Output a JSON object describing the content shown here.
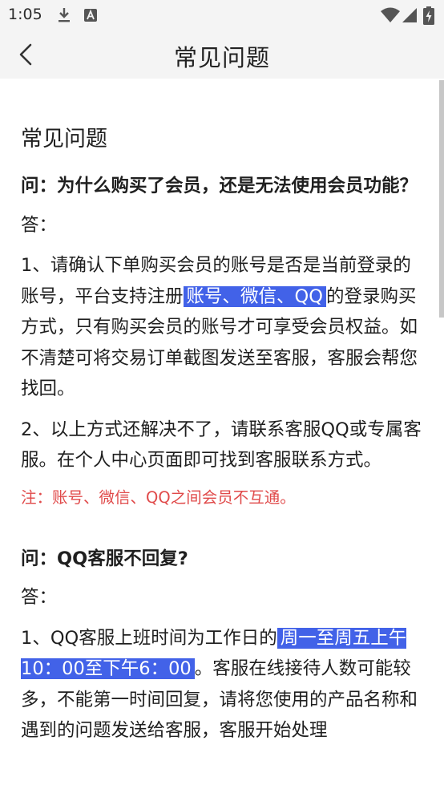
{
  "status_bar": {
    "time": "1:05",
    "icons": [
      "download-icon",
      "font-a-icon",
      "wifi-icon",
      "signal-icon",
      "battery-charging-icon"
    ]
  },
  "app_bar": {
    "title": "常见问题"
  },
  "content": {
    "section_title": "常见问题",
    "faq": [
      {
        "question": "问：为什么购买了会员，还是无法使用会员功能？",
        "answer_label": "答：",
        "para1": {
          "before": "1、请确认下单购买会员的账号是否是当前登录的账号，平台支持注册",
          "highlight": "账号、微信、QQ",
          "after": "的登录购买方式，只有购买会员的账号才可享受会员权益。如不清楚可将交易订单截图发送至客服，客服会帮您找回。"
        },
        "para2": "2、以上方式还解决不了，请联系客服QQ或专属客服。在个人中心页面即可找到客服联系方式。",
        "note": "注：账号、微信、QQ之间会员不互通。"
      },
      {
        "question": "问：QQ客服不回复?",
        "answer_label": "答：",
        "para1": {
          "before": "1、QQ客服上班时间为工作日的",
          "highlight": "周一至周五上午10：00至下午6：00",
          "after": "。客服在线接待人数可能较多，不能第一时间回复，请将您使用的产品名称和遇到的问题发送给客服，客服开始处理"
        }
      }
    ]
  },
  "colors": {
    "highlight_bg": "#4262e8",
    "note_red": "#e04a4a",
    "bar_bg": "#f4f4f4"
  }
}
